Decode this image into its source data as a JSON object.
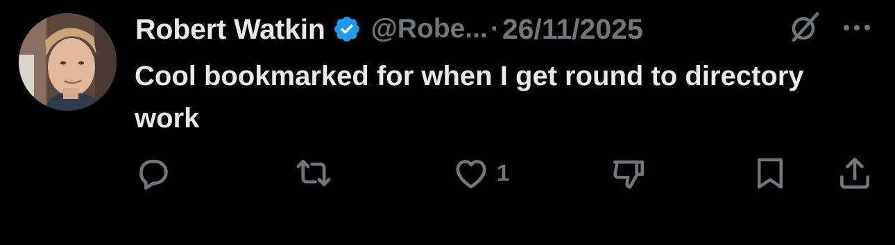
{
  "author": {
    "name": "Robert Watkin",
    "handle": "@Robe...",
    "verified": true
  },
  "meta": {
    "separator": "·",
    "date": "26/11/2025"
  },
  "tweet": {
    "text": "Cool bookmarked for when I get round to directory work"
  },
  "actions": {
    "reply": {
      "icon": "reply-icon",
      "count": ""
    },
    "repost": {
      "icon": "repost-icon",
      "count": ""
    },
    "like": {
      "icon": "like-icon",
      "count": "1"
    },
    "dislike": {
      "icon": "dislike-icon",
      "count": ""
    },
    "bookmark": {
      "icon": "bookmark-icon"
    },
    "share": {
      "icon": "share-icon"
    }
  },
  "colors": {
    "background": "#000000",
    "primary_text": "#e7e9ea",
    "secondary_text": "#71767b",
    "verified_badge": "#1d9bf0"
  }
}
